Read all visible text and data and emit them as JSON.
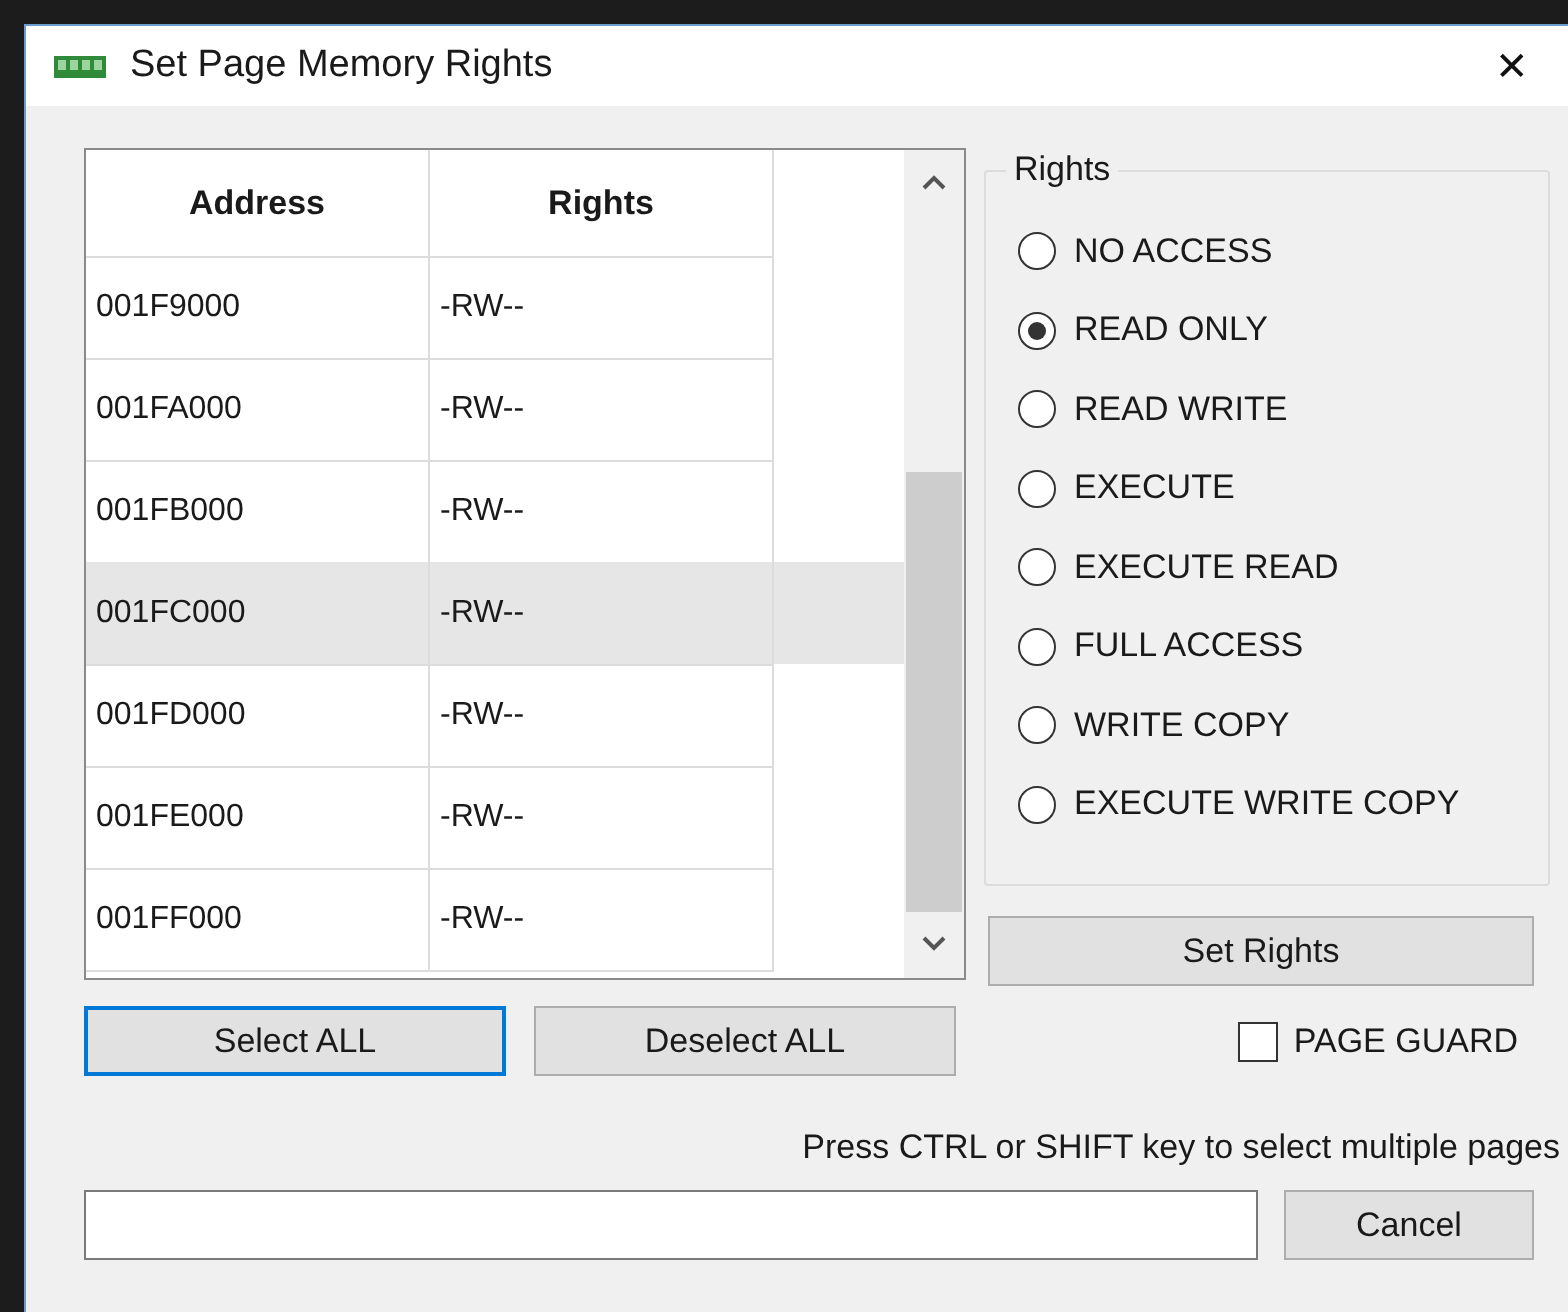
{
  "window": {
    "title": "Set Page Memory Rights",
    "close": "✕"
  },
  "table": {
    "columns": [
      "Address",
      "Rights"
    ],
    "rows": [
      {
        "address": "001F9000",
        "rights": "-RW--",
        "selected": false
      },
      {
        "address": "001FA000",
        "rights": "-RW--",
        "selected": false
      },
      {
        "address": "001FB000",
        "rights": "-RW--",
        "selected": false
      },
      {
        "address": "001FC000",
        "rights": "-RW--",
        "selected": true
      },
      {
        "address": "001FD000",
        "rights": "-RW--",
        "selected": false
      },
      {
        "address": "001FE000",
        "rights": "-RW--",
        "selected": false
      },
      {
        "address": "001FF000",
        "rights": "-RW--",
        "selected": false
      }
    ]
  },
  "rights_group": {
    "title": "Rights",
    "options": [
      {
        "label": "NO ACCESS",
        "selected": false
      },
      {
        "label": "READ ONLY",
        "selected": true
      },
      {
        "label": "READ WRITE",
        "selected": false
      },
      {
        "label": "EXECUTE",
        "selected": false
      },
      {
        "label": "EXECUTE READ",
        "selected": false
      },
      {
        "label": "FULL ACCESS",
        "selected": false
      },
      {
        "label": "WRITE COPY",
        "selected": false
      },
      {
        "label": "EXECUTE WRITE COPY",
        "selected": false
      }
    ]
  },
  "set_rights_button": "Set Rights",
  "select_buttons": [
    {
      "label": "Select ALL",
      "focused": true
    },
    {
      "label": "Deselect ALL",
      "focused": false
    }
  ],
  "page_guard": {
    "label": "PAGE GUARD",
    "checked": false
  },
  "hint": "Press CTRL or SHIFT key to select multiple pages",
  "cancel_button": "Cancel"
}
